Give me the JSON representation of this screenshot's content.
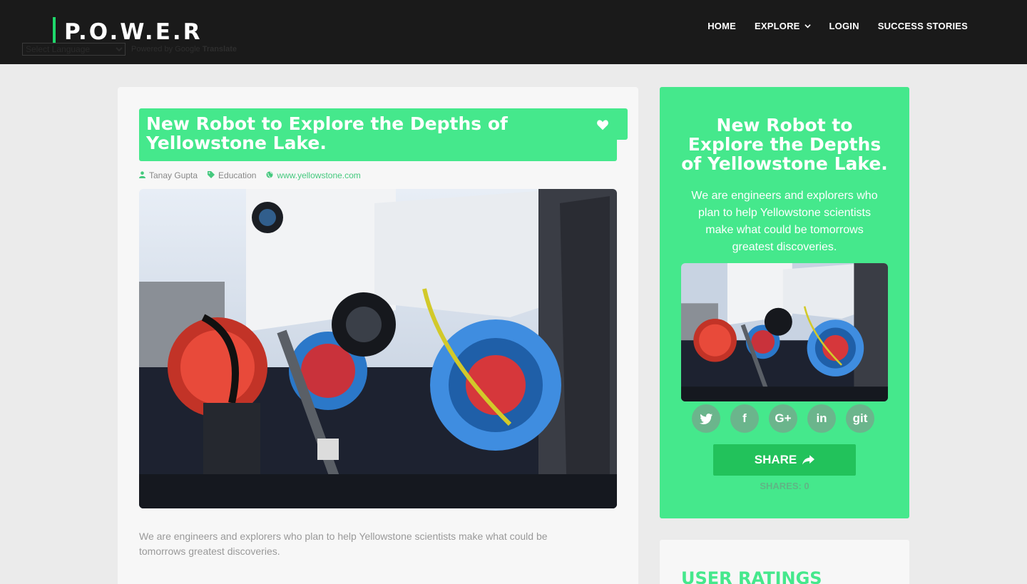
{
  "header": {
    "logo": "P.O.W.E.R",
    "translate_select": "Select Language",
    "powered_by": "Powered by",
    "google": "Google",
    "translate": "Translate",
    "nav": [
      {
        "label": "HOME"
      },
      {
        "label": "EXPLORE"
      },
      {
        "label": "LOGIN"
      },
      {
        "label": "SUCCESS STORIES"
      }
    ]
  },
  "article": {
    "title": "New Robot to Explore the Depths of Yellowstone Lake.",
    "author": "Tanay Gupta",
    "category": "Education",
    "website": "www.yellowstone.com",
    "excerpt": "We are engineers and explorers who plan to help Yellowstone scientists make what could be tomorrows greatest discoveries.",
    "icons": {
      "heart": "heart-icon",
      "author": "user-icon",
      "category": "tag-icon",
      "website": "globe-icon"
    }
  },
  "sidebar": {
    "title": "New Robot to Explore the Depths of Yellowstone Lake.",
    "description": "We are engineers and explorers who plan to help Yellowstone scientists make what could be tomorrows greatest discoveries.",
    "socials": [
      {
        "name": "twitter",
        "glyph": "🐦"
      },
      {
        "name": "facebook",
        "glyph": "f"
      },
      {
        "name": "google-plus",
        "glyph": "G+"
      },
      {
        "name": "linkedin",
        "glyph": "in"
      },
      {
        "name": "git",
        "glyph": "git"
      }
    ],
    "share_label": "SHARE",
    "shares_text": "SHARES: 0"
  },
  "ratings": {
    "title": "USER RATINGS"
  },
  "colors": {
    "accent": "#45e88c",
    "header_bg": "#1a1a1a",
    "share_button": "#22c25b"
  }
}
